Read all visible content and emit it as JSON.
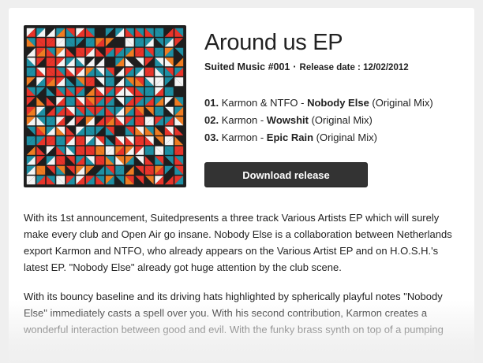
{
  "release": {
    "title": "Around us EP",
    "label": "Suited Music #001",
    "date_text": "Release date : 12/02/2012"
  },
  "tracks": [
    {
      "num": "01.",
      "artist": "Karmon & NTFO - ",
      "name": "Nobody Else",
      "mix": " (Original Mix)"
    },
    {
      "num": "02.",
      "artist": "Karmon - ",
      "name": "Wowshit",
      "mix": " (Original Mix)"
    },
    {
      "num": "03.",
      "artist": "Karmon - ",
      "name": "Epic Rain",
      "mix": " (Original Mix)"
    }
  ],
  "download_label": "Download release",
  "description": [
    "With its 1st announcement, Suitedpresents a three track Various Artists EP which will surely make every club and Open Air go insane. Nobody Else is a collaboration between Netherlands export Karmon and NTFO, who already appears on the Various Artist EP and on H.O.S.H.'s latest EP. \"Nobody Else\" already got huge attention by the club scene.",
    "With its bouncy baseline and its driving hats highlighted by spherically playful notes \"Nobody Else\" immediately casts a spell over you. With his second contribution, Karmon creates a wonderful interaction between good and evil. With the funky brass synth on top of a pumping"
  ],
  "cover_colors": [
    "#e8342a",
    "#1e8fa3",
    "#f4f4f4",
    "#ef7c22",
    "#1e1e1e"
  ]
}
